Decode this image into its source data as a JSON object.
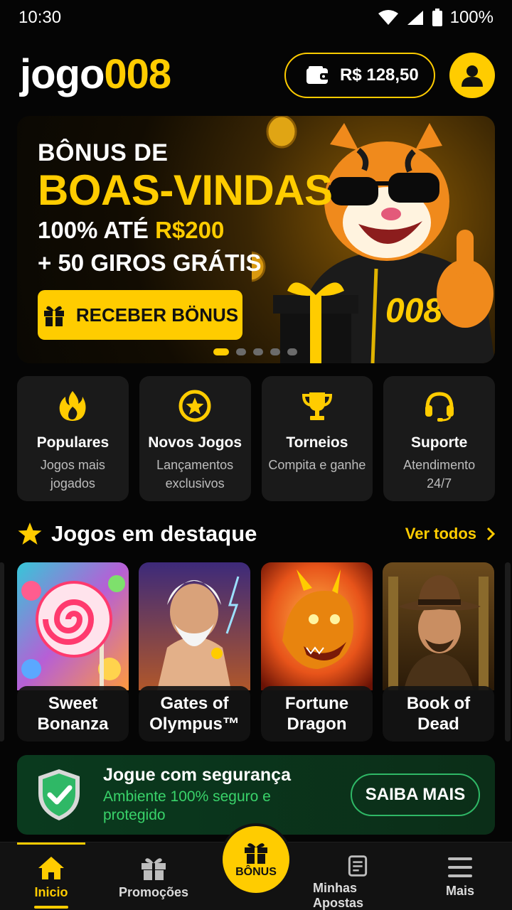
{
  "status_bar": {
    "time": "10:30",
    "battery": "100%"
  },
  "header": {
    "logo_part1": "jogo",
    "logo_part2": "008",
    "balance": "R$ 128,50",
    "icons": {
      "wallet": "wallet-icon",
      "profile": "user-icon"
    }
  },
  "banner": {
    "line1": "BÔNUS DE",
    "line2": "BOAS-VINDAS",
    "line3_prefix": "100% ATÉ ",
    "line3_highlight": "R$200",
    "line4": "+ 50 GIROS GRÁTIS",
    "cta": "RECEBER BÖNUS",
    "mascot_text": "008",
    "slides": 5,
    "active_slide": 1
  },
  "categories": [
    {
      "title": "Populares",
      "subtitle": "Jogos mais jogados",
      "icon": "flame-icon"
    },
    {
      "title": "Novos Jogos",
      "subtitle": "Lançamentos exclusivos",
      "icon": "star-badge-icon"
    },
    {
      "title": "Torneios",
      "subtitle": "Compita e ganhe",
      "icon": "trophy-icon"
    },
    {
      "title": "Suporte",
      "subtitle": "Atendimento 24/7",
      "icon": "headset-icon"
    }
  ],
  "featured": {
    "title": "Jogos em destaque",
    "see_all": "Ver todos",
    "games": [
      {
        "name": "Sweet Bonanza"
      },
      {
        "name": "Gates of Olympus™"
      },
      {
        "name": "Fortune Dragon"
      },
      {
        "name": "Book of Dead"
      }
    ]
  },
  "security": {
    "title": "Jogue com segurança",
    "subtitle": "Ambiente 100% seguro e protegido",
    "button": "SAIBA MAIS"
  },
  "bottom_nav": {
    "home": "Inicio",
    "promotions": "Promoções",
    "bonus": "BÔNUS",
    "bets": "Minhas Apostas",
    "more": "Mais"
  },
  "colors": {
    "accent": "#ffcc00",
    "background": "#050505",
    "card": "#1a1a1a",
    "success": "#39d36a"
  }
}
